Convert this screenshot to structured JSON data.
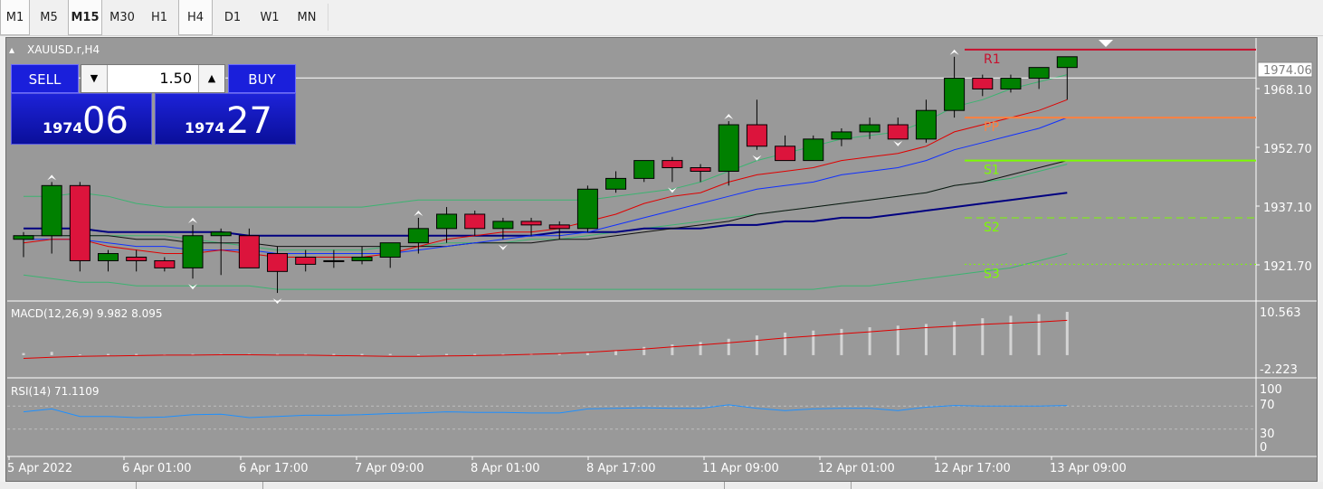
{
  "toolbar": {
    "timeframes": [
      {
        "label": "M1",
        "active": true,
        "bold": false
      },
      {
        "label": "M5",
        "active": false,
        "bold": false
      },
      {
        "label": "M15",
        "active": true,
        "bold": true
      },
      {
        "label": "M30",
        "active": false,
        "bold": false
      },
      {
        "label": "H1",
        "active": false,
        "bold": false
      },
      {
        "label": "H4",
        "active": true,
        "bold": false
      },
      {
        "label": "D1",
        "active": false,
        "bold": false
      },
      {
        "label": "W1",
        "active": false,
        "bold": false
      },
      {
        "label": "MN",
        "active": false,
        "bold": false
      }
    ]
  },
  "chart": {
    "symbol_label": "XAUUSD.r,H4",
    "current_price": "1974.06",
    "price_ticks": [
      "1968.10",
      "1952.70",
      "1937.10",
      "1921.70"
    ],
    "pivot_labels": {
      "r1": "R1",
      "pp": "PP",
      "s1": "S1",
      "s2": "S2",
      "s3": "S3"
    },
    "time_labels": [
      "5 Apr 2022",
      "6 Apr 01:00",
      "6 Apr 17:00",
      "7 Apr 09:00",
      "8 Apr 01:00",
      "8 Apr 17:00",
      "11 Apr 09:00",
      "12 Apr 01:00",
      "12 Apr 17:00",
      "13 Apr 09:00"
    ],
    "colors": {
      "bull": "#008000",
      "bear": "#dc143c",
      "r1": "#c8102e",
      "pp": "#ff8040",
      "s1": "#7cfc00",
      "s2": "#7cfc00",
      "s3": "#7cfc00",
      "band": "#3cb371",
      "ma_red": "#e00000",
      "ma_blue": "#1030ff",
      "ma_black": "#101010",
      "ma_navy": "#000080"
    }
  },
  "trade_panel": {
    "sell_label": "SELL",
    "buy_label": "BUY",
    "lot": "1.50",
    "sell_small": "1974",
    "sell_big": "06",
    "buy_small": "1974",
    "buy_big": "27"
  },
  "macd": {
    "label": "MACD(12,26,9) 9.982 8.095",
    "tick_high": "10.563",
    "tick_low": "-2.223"
  },
  "rsi": {
    "label": "RSI(14) 71.1109",
    "ticks": [
      "100",
      "70",
      "30",
      "0"
    ]
  },
  "chart_data": {
    "type": "candlestick",
    "candles": [
      [
        1929,
        1931,
        1924,
        1930
      ],
      [
        1930,
        1945,
        1925,
        1944
      ],
      [
        1944,
        1945,
        1920,
        1923
      ],
      [
        1923,
        1926,
        1920,
        1925
      ],
      [
        1924,
        1926,
        1920,
        1923
      ],
      [
        1923,
        1924,
        1920,
        1921
      ],
      [
        1921,
        1933,
        1918,
        1930
      ],
      [
        1930,
        1932,
        1919,
        1931
      ],
      [
        1930,
        1932,
        1924,
        1921
      ],
      [
        1925,
        1927,
        1914,
        1920
      ],
      [
        1924,
        1926,
        1920,
        1922
      ],
      [
        1923,
        1926,
        1921,
        1923
      ],
      [
        1923,
        1927,
        1922,
        1924
      ],
      [
        1924,
        1928,
        1921,
        1928
      ],
      [
        1928,
        1935,
        1925,
        1932
      ],
      [
        1932,
        1938,
        1928,
        1936
      ],
      [
        1936,
        1937,
        1930,
        1932
      ],
      [
        1932,
        1935,
        1929,
        1934
      ],
      [
        1934,
        1935,
        1930,
        1933
      ],
      [
        1933,
        1934,
        1929,
        1932
      ],
      [
        1932,
        1944,
        1931,
        1943
      ],
      [
        1943,
        1948,
        1942,
        1946
      ],
      [
        1946,
        1949,
        1945,
        1951
      ],
      [
        1951,
        1952,
        1945,
        1949
      ],
      [
        1949,
        1950,
        1945,
        1948
      ],
      [
        1948,
        1962,
        1944,
        1961
      ],
      [
        1961,
        1968,
        1954,
        1955
      ],
      [
        1955,
        1958,
        1952,
        1951
      ],
      [
        1951,
        1958,
        1951,
        1957
      ],
      [
        1957,
        1960,
        1955,
        1959
      ],
      [
        1959,
        1963,
        1957,
        1961
      ],
      [
        1961,
        1963,
        1958,
        1957
      ],
      [
        1957,
        1968,
        1956,
        1965
      ],
      [
        1965,
        1980,
        1963,
        1974
      ],
      [
        1974,
        1975,
        1969,
        1971
      ],
      [
        1971,
        1975,
        1970,
        1974
      ],
      [
        1974,
        1977,
        1971,
        1977
      ],
      [
        1977,
        1980,
        1968,
        1980
      ]
    ],
    "bands": {
      "upper": [
        1941,
        1941,
        1942,
        1941,
        1939,
        1938,
        1938,
        1938,
        1938,
        1938,
        1938,
        1938,
        1938,
        1939,
        1940,
        1940,
        1940,
        1940,
        1940,
        1940,
        1940,
        1941,
        1942,
        1943,
        1945,
        1948,
        1951,
        1953,
        1955,
        1957,
        1958,
        1959,
        1962,
        1966,
        1968,
        1971,
        1973,
        1975
      ],
      "middle": [
        1930,
        1930,
        1930,
        1930,
        1930,
        1930,
        1929,
        1928,
        1927,
        1926,
        1926,
        1926,
        1926,
        1927,
        1927,
        1928,
        1928,
        1928,
        1929,
        1929,
        1930,
        1931,
        1932,
        1933,
        1934,
        1935,
        1936,
        1937,
        1938,
        1939,
        1940,
        1941,
        1942,
        1944,
        1945,
        1946,
        1948,
        1950
      ],
      "lower": [
        1919,
        1918,
        1917,
        1917,
        1916,
        1916,
        1916,
        1916,
        1916,
        1915,
        1915,
        1915,
        1915,
        1915,
        1915,
        1915,
        1915,
        1915,
        1915,
        1915,
        1915,
        1915,
        1915,
        1915,
        1915,
        1915,
        1915,
        1915,
        1915,
        1916,
        1916,
        1917,
        1918,
        1919,
        1920,
        1921,
        1923,
        1925
      ]
    },
    "ma_red": [
      1928,
      1929,
      1929,
      1927,
      1926,
      1925,
      1925,
      1926,
      1925,
      1924,
      1924,
      1924,
      1924,
      1925,
      1927,
      1929,
      1930,
      1931,
      1931,
      1932,
      1934,
      1936,
      1939,
      1941,
      1942,
      1945,
      1947,
      1948,
      1949,
      1951,
      1952,
      1953,
      1955,
      1959,
      1961,
      1963,
      1965,
      1968
    ],
    "ma_blue": [
      1929,
      1929,
      1929,
      1928,
      1927,
      1927,
      1926,
      1926,
      1926,
      1925,
      1925,
      1925,
      1925,
      1925,
      1926,
      1927,
      1928,
      1929,
      1930,
      1930,
      1931,
      1933,
      1935,
      1937,
      1939,
      1941,
      1943,
      1944,
      1945,
      1947,
      1948,
      1949,
      1951,
      1954,
      1956,
      1958,
      1960,
      1963
    ],
    "ma_black": [
      1930,
      1930,
      1930,
      1930,
      1929,
      1929,
      1928,
      1928,
      1928,
      1927,
      1927,
      1927,
      1927,
      1927,
      1927,
      1927,
      1928,
      1928,
      1928,
      1929,
      1929,
      1930,
      1931,
      1932,
      1933,
      1934,
      1936,
      1937,
      1938,
      1939,
      1940,
      1941,
      1942,
      1944,
      1945,
      1947,
      1949,
      1951
    ],
    "ma_navy": [
      1932,
      1932,
      1932,
      1931,
      1931,
      1931,
      1931,
      1931,
      1930,
      1930,
      1930,
      1930,
      1930,
      1930,
      1930,
      1930,
      1930,
      1930,
      1930,
      1931,
      1931,
      1931,
      1932,
      1932,
      1932,
      1933,
      1933,
      1934,
      1934,
      1935,
      1935,
      1936,
      1937,
      1938,
      1939,
      1940,
      1941,
      1942
    ],
    "pivots": {
      "r1": 1982,
      "pp": 1963,
      "s1": 1951,
      "s2": 1935,
      "s3": 1922
    },
    "macd_hist": [
      0.5,
      0.8,
      0.2,
      0.3,
      0.3,
      0.2,
      0.3,
      0.3,
      0.3,
      0.3,
      0.3,
      0.3,
      0.3,
      0.3,
      0.2,
      0.3,
      0.3,
      0.3,
      0.4,
      0.3,
      0.5,
      1.2,
      2,
      2.6,
      3.2,
      4,
      4.8,
      5.5,
      6,
      6.4,
      6.8,
      7.2,
      7.6,
      8.2,
      9,
      9.6,
      10,
      10.56
    ],
    "macd_signal": [
      -0.8,
      -0.5,
      -0.3,
      -0.2,
      -0.1,
      0,
      0,
      0.1,
      0.1,
      0,
      0,
      -0.1,
      -0.2,
      -0.3,
      -0.3,
      -0.2,
      -0.1,
      0,
      0.2,
      0.4,
      0.7,
      1.1,
      1.5,
      2,
      2.5,
      3,
      3.6,
      4.2,
      4.7,
      5.2,
      5.7,
      6.2,
      6.7,
      7.1,
      7.5,
      7.8,
      8.1,
      8.5
    ],
    "rsi": [
      60,
      65,
      52,
      52,
      50,
      51,
      55,
      56,
      50,
      52,
      54,
      54,
      55,
      57,
      58,
      60,
      59,
      59,
      58,
      58,
      65,
      66,
      67,
      66,
      66,
      72,
      66,
      62,
      65,
      66,
      66,
      62,
      68,
      71,
      70,
      70,
      70,
      71
    ],
    "ylim": [
      1912,
      1985
    ],
    "macd_ylim": [
      -2.223,
      10.563
    ],
    "rsi_ylim": [
      0,
      100
    ]
  }
}
